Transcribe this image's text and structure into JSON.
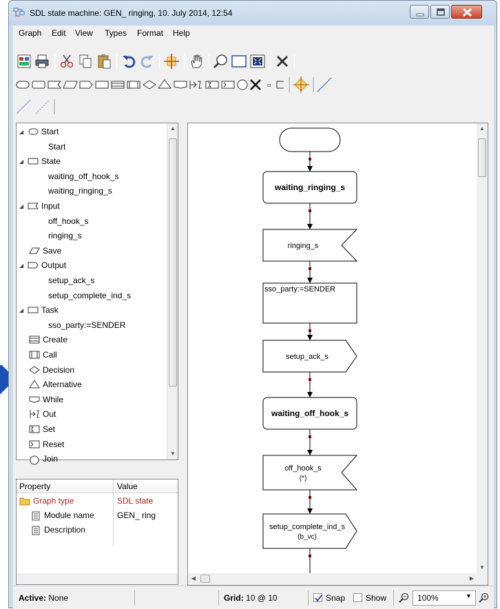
{
  "window": {
    "title": "SDL state machine: GEN_ ringing, 10. July 2014, 12:54"
  },
  "menu": [
    {
      "label": "Graph"
    },
    {
      "label": "Edit"
    },
    {
      "label": "View"
    },
    {
      "label": "Types"
    },
    {
      "label": "Format"
    },
    {
      "label": "Help"
    }
  ],
  "toolbar_main_icons": [
    "properties-icon",
    "print-icon",
    "cut-icon",
    "copy-icon",
    "paste-icon",
    "undo-icon",
    "redo-icon",
    "align-icon",
    "pan-hand-icon",
    "zoom-icon",
    "rectangle-select-icon",
    "fit-icon",
    "delete-icon"
  ],
  "toolbar_shape_icons": [
    "start-shape",
    "state-shape",
    "input-shape",
    "save-shape",
    "output-shape",
    "task-shape",
    "create-shape",
    "call-shape",
    "decision-shape",
    "alternative-shape",
    "while-shape",
    "out-shape",
    "set-shape",
    "reset-shape",
    "join-shape",
    "stop-shape",
    "comment-shape",
    "text-shape",
    "connector-shape",
    "line-shape"
  ],
  "tree": {
    "rows": [
      {
        "kind": "root",
        "label": "Start",
        "icon": "start-shape"
      },
      {
        "kind": "child",
        "label": "Start"
      },
      {
        "kind": "root",
        "label": "State",
        "icon": "state-shape"
      },
      {
        "kind": "child",
        "label": "waiting_off_hook_s"
      },
      {
        "kind": "child",
        "label": "waiting_ringing_s"
      },
      {
        "kind": "root",
        "label": "Input",
        "icon": "input-shape"
      },
      {
        "kind": "child",
        "label": "off_hook_s"
      },
      {
        "kind": "child",
        "label": "ringing_s"
      },
      {
        "kind": "leaf",
        "label": "Save",
        "icon": "save-shape"
      },
      {
        "kind": "root",
        "label": "Output",
        "icon": "output-shape"
      },
      {
        "kind": "child",
        "label": "setup_ack_s"
      },
      {
        "kind": "child",
        "label": "setup_complete_ind_s"
      },
      {
        "kind": "root",
        "label": "Task",
        "icon": "task-shape"
      },
      {
        "kind": "child",
        "label": "sso_party:=SENDER"
      },
      {
        "kind": "leaf",
        "label": "Create",
        "icon": "create-shape"
      },
      {
        "kind": "leaf",
        "label": "Call",
        "icon": "call-shape"
      },
      {
        "kind": "leaf",
        "label": "Decision",
        "icon": "decision-shape"
      },
      {
        "kind": "leaf",
        "label": "Alternative",
        "icon": "alternative-shape"
      },
      {
        "kind": "leaf",
        "label": "While",
        "icon": "while-shape"
      },
      {
        "kind": "leaf",
        "label": "Out",
        "icon": "out-shape"
      },
      {
        "kind": "leaf",
        "label": "Set",
        "icon": "set-shape"
      },
      {
        "kind": "leaf",
        "label": "Reset",
        "icon": "reset-shape"
      },
      {
        "kind": "leaf",
        "label": "Join",
        "icon": "join-shape"
      }
    ]
  },
  "properties": {
    "header_property": "Property",
    "header_value": "Value",
    "rows": [
      {
        "property": "Graph type",
        "value": "SDL state",
        "icon": "folder-icon"
      },
      {
        "property": "Module name",
        "value": "GEN_ ring",
        "icon": "document-icon"
      },
      {
        "property": "Description",
        "value": "",
        "icon": "document-icon"
      }
    ]
  },
  "diagram": {
    "nodes": [
      {
        "type": "start",
        "label": ""
      },
      {
        "type": "state",
        "label": "waiting_ringing_s"
      },
      {
        "type": "input",
        "label": "ringing_s"
      },
      {
        "type": "task",
        "label": "sso_party:=SENDER"
      },
      {
        "type": "output",
        "label": "setup_ack_s"
      },
      {
        "type": "state",
        "label": "waiting_off_hook_s"
      },
      {
        "type": "input",
        "label": "off_hook_s",
        "label2": "(*)"
      },
      {
        "type": "output",
        "label": "setup_complete_ind_s",
        "label2": "(b_vc)"
      }
    ]
  },
  "status": {
    "active_label": "Active:",
    "active_value": "None",
    "grid_label": "Grid:",
    "grid_value": "10 @ 10",
    "snap_label": "Snap",
    "snap_checked": true,
    "show_label": "Show",
    "show_checked": false,
    "zoom_value": "100%"
  },
  "colors": {
    "connector_dot": "#8b0000",
    "shape_border": "#000000",
    "titlebar": "#c5d6e9"
  }
}
